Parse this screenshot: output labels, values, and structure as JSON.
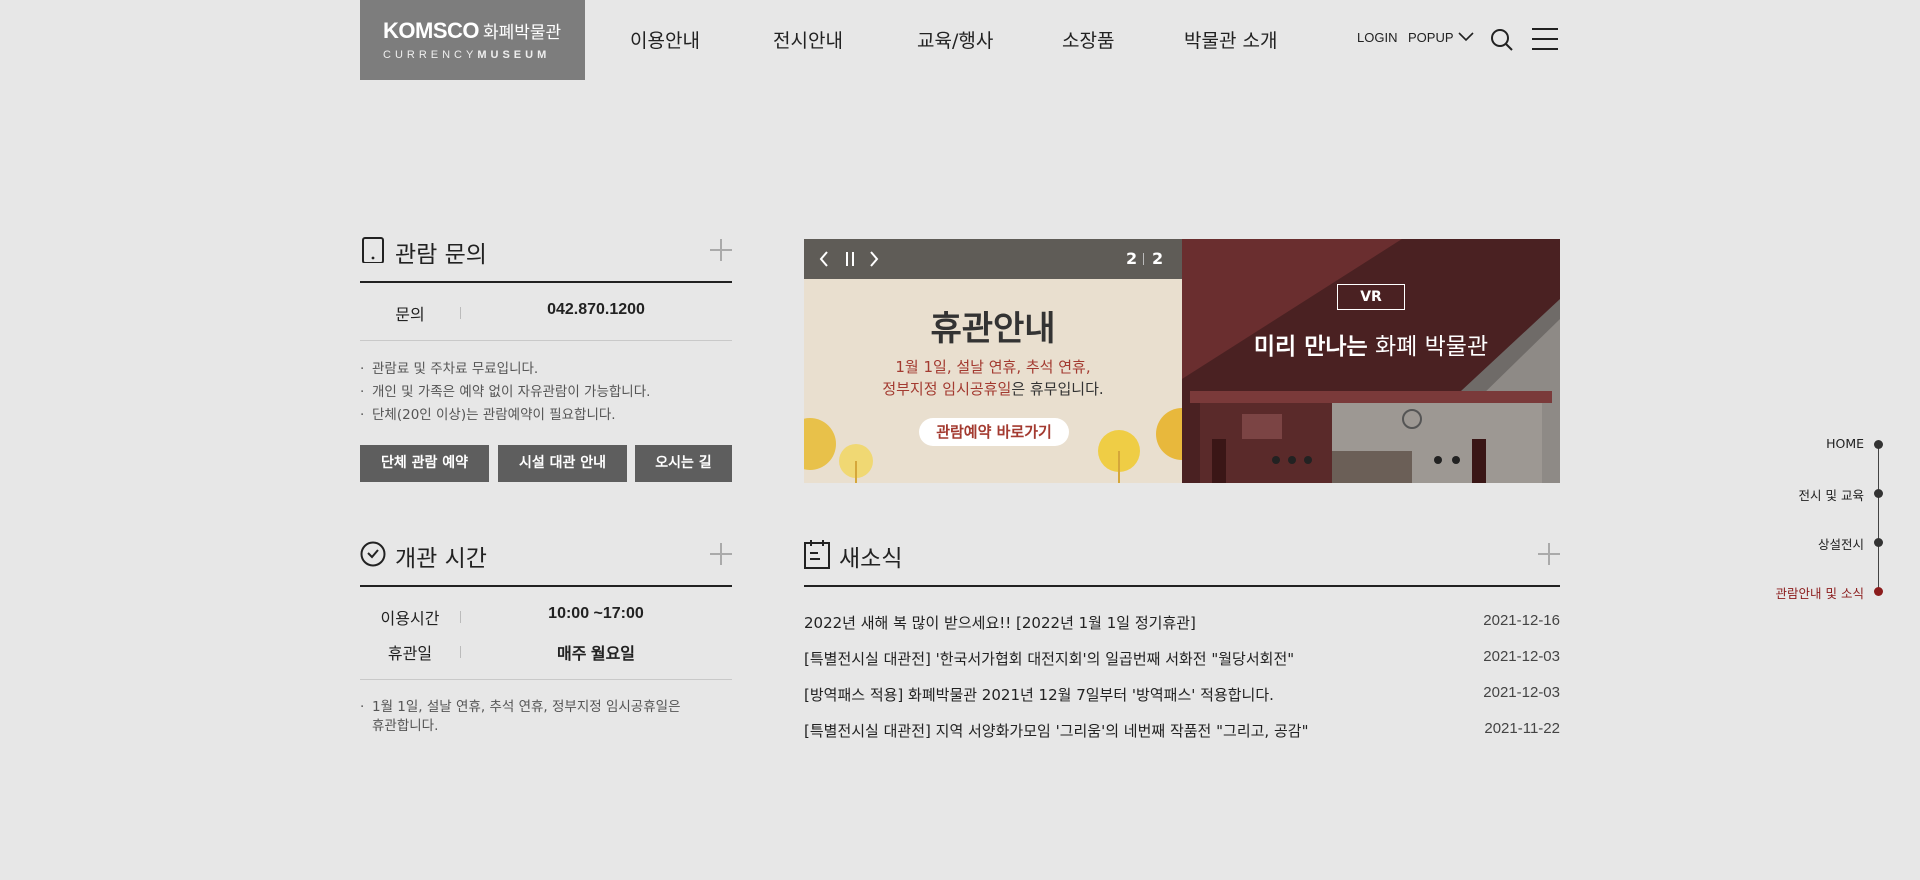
{
  "header": {
    "logo_brand": "KOMSCO",
    "logo_brand_kr": "화폐박물관",
    "logo_sub_light": "CURRENCY",
    "logo_sub_bold": "MUSEUM",
    "nav": [
      "이용안내",
      "전시안내",
      "교육/행사",
      "소장품",
      "박물관 소개"
    ],
    "login_label": "LOGIN",
    "popup_label": "POPUP"
  },
  "visit_inquiry": {
    "title": "관람 문의",
    "row_label": "문의",
    "row_value": "042.870.1200",
    "notes": [
      "관람료 및 주차료 무료입니다.",
      "개인 및 가족은 예약 없이 자유관람이 가능합니다.",
      "단체(20인 이상)는 관람예약이 필요합니다."
    ],
    "buttons": [
      "단체 관람 예약",
      "시설 대관 안내",
      "오시는 길"
    ]
  },
  "opening_hours": {
    "title": "개관 시간",
    "rows": [
      {
        "label": "이용시간",
        "value": "10:00 ~17:00"
      },
      {
        "label": "휴관일",
        "value": "매주 월요일"
      }
    ],
    "note": "1월 1일, 설날 연휴, 추석 연휴, 정부지정 임시공휴일은 휴관합니다."
  },
  "banner": {
    "current": "2",
    "total": "2",
    "slide1": {
      "title": "휴관안내",
      "line1": "1월 1일, 설날 연휴, 추석 연휴,",
      "line2_red": "정부지정 임시공휴일",
      "line2_plain": "은 휴무입니다.",
      "button": "관람예약 바로가기"
    },
    "slide2": {
      "badge": "VR",
      "title_bold": "미리 만나는",
      "title_rest": " 화폐 박물관"
    }
  },
  "news": {
    "title": "새소식",
    "items": [
      {
        "title": "2022년 새해 복 많이 받으세요!! [2022년 1월 1일 정기휴관]",
        "date": "2021-12-16"
      },
      {
        "title": "[특별전시실 대관전] '한국서가협회 대전지회'의 일곱번째 서화전 \"월당서회전\"",
        "date": "2021-12-03"
      },
      {
        "title": "[방역패스 적용] 화폐박물관 2021년 12월 7일부터 '방역패스' 적용합니다.",
        "date": "2021-12-03"
      },
      {
        "title": "[특별전시실 대관전] 지역 서양화가모임 '그리움'의 네번째 작품전 \"그리고, 공감\"",
        "date": "2021-11-22"
      }
    ]
  },
  "side_nav": {
    "items": [
      "HOME",
      "전시 및 교육",
      "상설전시",
      "관람안내 및 소식"
    ],
    "active_color": "#8b1c1c"
  },
  "colors": {
    "background": "#e7e7e7",
    "logo_bg": "#7d7d7d",
    "button_bg": "#5e5e5e",
    "accent_red": "#a33a30"
  }
}
